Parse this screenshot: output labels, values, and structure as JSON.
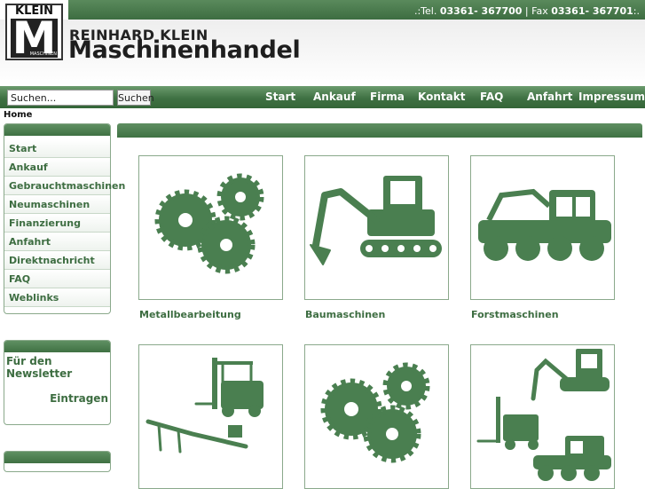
{
  "header": {
    "contact_prefix": ".:Tel. ",
    "phone": "03361- 367700",
    "fax_prefix": " | Fax ",
    "fax": "03361- 367701",
    "contact_suffix": ":.",
    "brand_line1": "REINHARD KLEIN",
    "brand_line2": "Maschinenhandel",
    "logo_top": "KLEIN",
    "logo_letter": "M",
    "logo_small": "MASCHINEN"
  },
  "search": {
    "value": "Suchen...",
    "button_label": "Suchen"
  },
  "nav": {
    "items": [
      "Start",
      "Ankauf",
      "Firma",
      "Kontakt",
      "FAQ",
      "Anfahrt",
      "Impressum"
    ]
  },
  "breadcrumb": "Home",
  "sidebar": {
    "items": [
      "Start",
      "Ankauf",
      "Gebrauchtmaschinen",
      "Neumaschinen",
      "Finanzierung",
      "Anfahrt",
      "Direktnachricht",
      "FAQ",
      "Weblinks"
    ]
  },
  "newsletter": {
    "title": "Für den Newsletter",
    "link": "Eintragen"
  },
  "categories": [
    {
      "label": "Metallbearbeitung",
      "icon": "gears-icon"
    },
    {
      "label": "Baumaschinen",
      "icon": "excavator-icon"
    },
    {
      "label": "Forstmaschinen",
      "icon": "forestry-machine-icon"
    },
    {
      "label": "",
      "icon": "forklift-icon"
    },
    {
      "label": "",
      "icon": "gears-icon"
    },
    {
      "label": "",
      "icon": "machines-collage-icon"
    }
  ],
  "colors": {
    "accent": "#3d6d41",
    "silhouette": "#4a7f50"
  }
}
